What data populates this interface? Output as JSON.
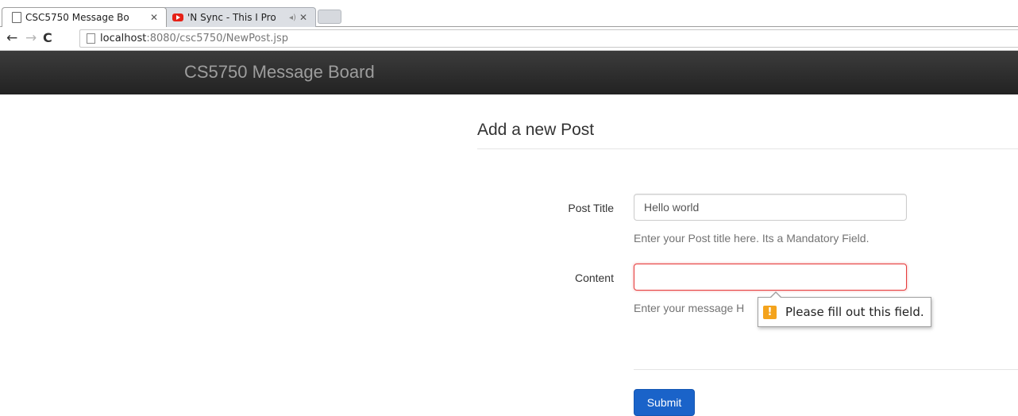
{
  "browser": {
    "tabs": [
      {
        "title": "CSC5750 Message Bo",
        "active": true,
        "icon": "page-icon"
      },
      {
        "title": "'N Sync - This I Pro",
        "active": false,
        "icon": "youtube-icon",
        "audio": true
      }
    ],
    "url_host": "localhost",
    "url_rest": ":8080/csc5750/NewPost.jsp"
  },
  "navbar": {
    "brand": "CS5750 Message Board"
  },
  "form": {
    "legend": "Add a new Post",
    "title_label": "Post Title",
    "title_value": "Hello world",
    "title_help": "Enter your Post title here. Its a Mandatory Field.",
    "content_label": "Content",
    "content_value": "",
    "content_help": "Enter your message H",
    "validation_message": "Please fill out this field.",
    "submit_label": "Submit"
  },
  "colors": {
    "navbar": "#222222",
    "brand_text": "#9d9d9d",
    "submit": "#1a63c9",
    "invalid_border": "#e63c3c",
    "warning": "#f4a31c"
  }
}
